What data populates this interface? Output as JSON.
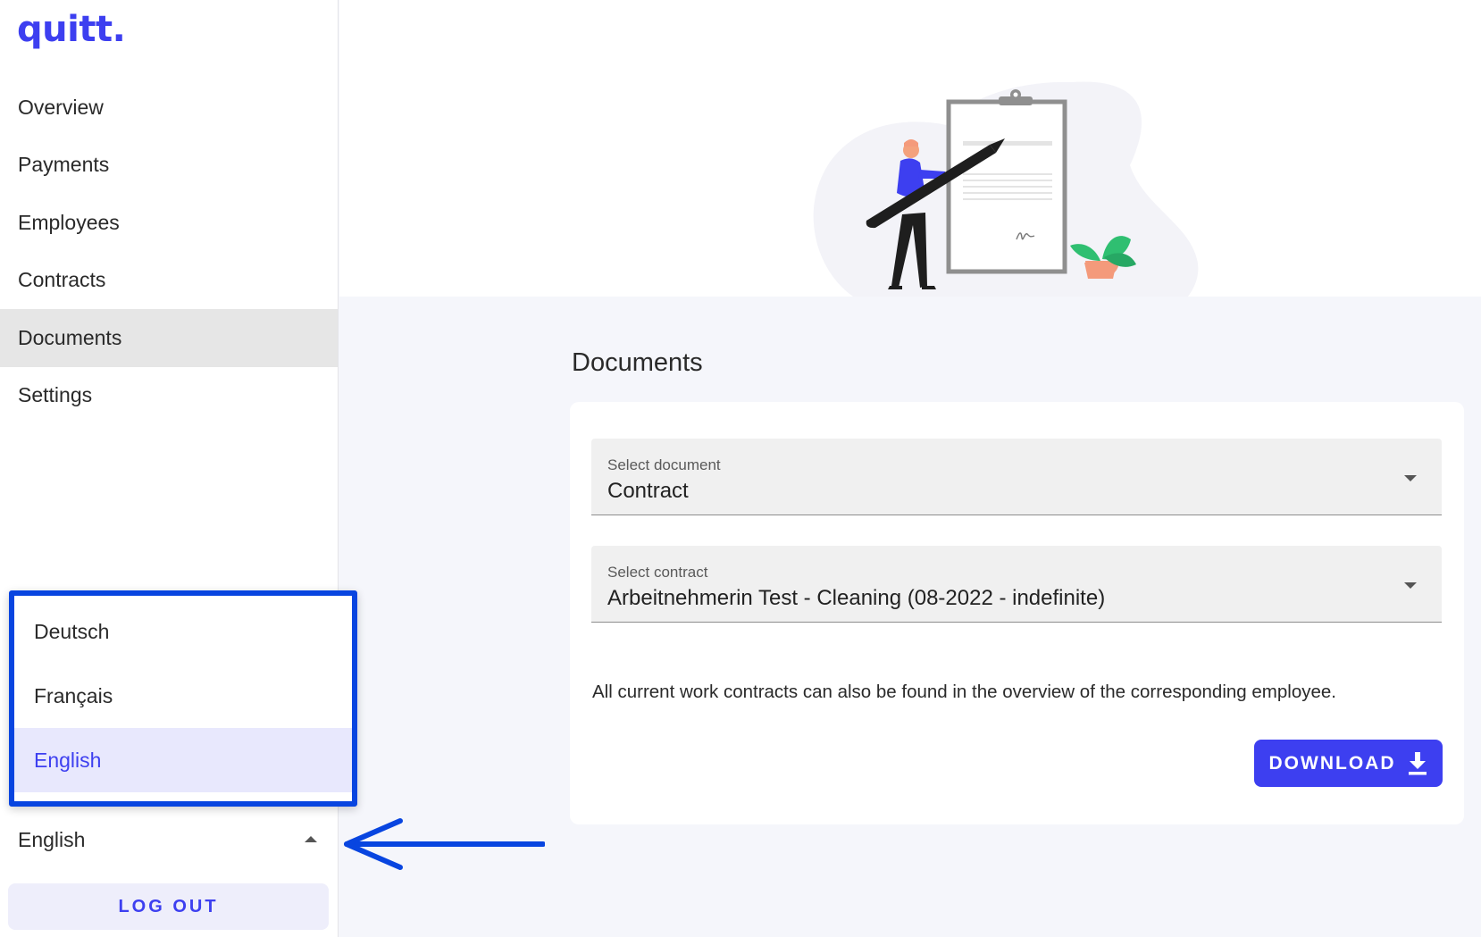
{
  "app": {
    "logo": "quitt."
  },
  "sidebar": {
    "items": [
      {
        "label": "Overview"
      },
      {
        "label": "Payments"
      },
      {
        "label": "Employees"
      },
      {
        "label": "Contracts"
      },
      {
        "label": "Documents",
        "active": true
      },
      {
        "label": "Settings"
      }
    ],
    "language_menu": {
      "options": [
        {
          "label": "Deutsch"
        },
        {
          "label": "Français"
        },
        {
          "label": "English",
          "selected": true
        }
      ]
    },
    "language_select": {
      "value": "English",
      "icon": "caret-up-icon"
    },
    "logout_label": "LOG OUT"
  },
  "main": {
    "title": "Documents",
    "document_select": {
      "label": "Select document",
      "value": "Contract",
      "icon": "caret-down-icon"
    },
    "contract_select": {
      "label": "Select contract",
      "value": "Arbeitnehmerin Test - Cleaning (08-2022 - indefinite)",
      "icon": "caret-down-icon"
    },
    "info_text": "All current work contracts can also be found in the overview of the corresponding employee.",
    "download_label": "DOWNLOAD",
    "download_icon": "download-icon"
  },
  "colors": {
    "brand": "#3d3ff0",
    "annotation": "#0845e0",
    "active_nav": "#e6e6e6",
    "selected_option": "#e8e8fd"
  }
}
